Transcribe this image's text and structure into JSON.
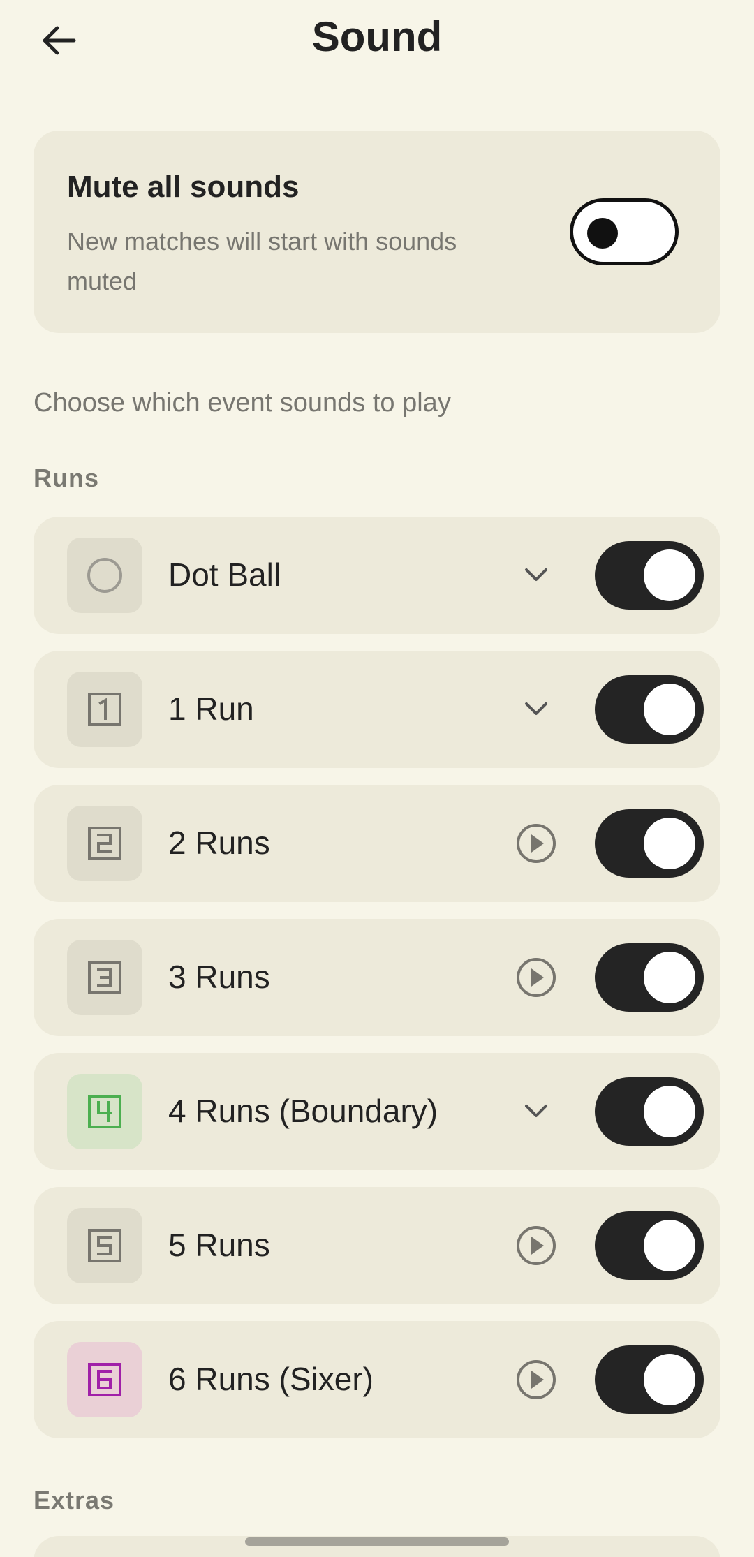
{
  "header": {
    "title": "Sound",
    "back_icon": "arrow-left-icon"
  },
  "mute": {
    "title": "Mute all sounds",
    "subtitle": "New matches will start with sounds muted",
    "enabled": false
  },
  "section_note": "Choose which event sounds to play",
  "groups": [
    {
      "label": "Runs",
      "items": [
        {
          "label": "Dot Ball",
          "icon": "circle-icon",
          "action": "chevron-down-icon",
          "enabled": true
        },
        {
          "label": "1 Run",
          "icon": "digit-1-icon",
          "action": "chevron-down-icon",
          "enabled": true
        },
        {
          "label": "2 Runs",
          "icon": "digit-2-icon",
          "action": "play-icon",
          "enabled": true
        },
        {
          "label": "3 Runs",
          "icon": "digit-3-icon",
          "action": "play-icon",
          "enabled": true
        },
        {
          "label": "4 Runs (Boundary)",
          "icon": "digit-4-icon",
          "action": "chevron-down-icon",
          "enabled": true
        },
        {
          "label": "5 Runs",
          "icon": "digit-5-icon",
          "action": "play-icon",
          "enabled": true
        },
        {
          "label": "6 Runs (Sixer)",
          "icon": "digit-6-icon",
          "action": "play-icon",
          "enabled": true
        }
      ]
    },
    {
      "label": "Extras",
      "items": []
    }
  ],
  "colors": {
    "background": "#f7f5e8",
    "card": "#edeada",
    "toggle_on": "#242424",
    "boundary_accent": "#4caf50",
    "sixer_accent": "#a020a8"
  }
}
